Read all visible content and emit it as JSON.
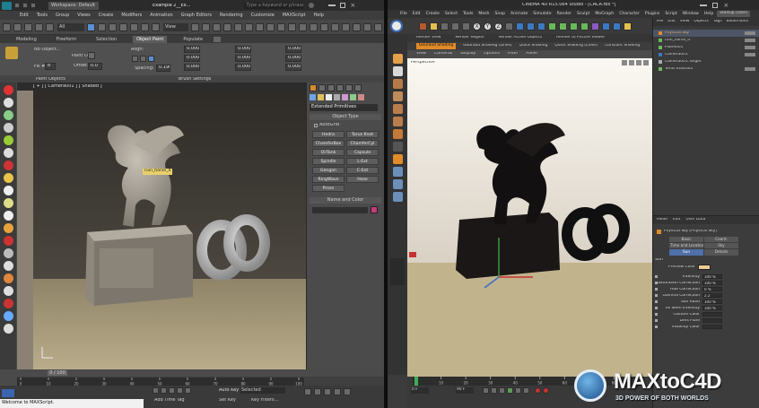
{
  "max": {
    "title_tabs": [
      "Workspace: Default",
      "Example 2__Ex..."
    ],
    "search_placeholder": "Type a keyword or phrase",
    "menu": [
      "Edit",
      "Tools",
      "Group",
      "Views",
      "Create",
      "Modifiers",
      "Animation",
      "Graph Editors",
      "Rendering",
      "Customize",
      "MAXScript",
      "Help"
    ],
    "toolbar": {
      "selection_filter": "All",
      "view_dropdown": "View"
    },
    "ribbon_tabs": [
      "Modeling",
      "Freeform",
      "Selection",
      "Object Paint",
      "Populate"
    ],
    "ribbon_active_tab": "Object Paint",
    "ribbon": {
      "no_object": "No Object...",
      "paint_on": "Paint On:",
      "fill": "Fill #:",
      "fill_value": "8",
      "offset": "Offset:",
      "offset_value": "0.0",
      "align": "Align:",
      "spacing": "Spacing:",
      "spacing_value": "0.190",
      "scale_rows": [
        "0.000",
        "0.000",
        "0.000",
        "0.000"
      ],
      "paint_objects": "Paint Objects",
      "brush_settings": "Brush Settings"
    },
    "viewport_label": "[ + ] [ Camera001 ] [ Shaded ]",
    "object_tooltip": "ruin_horse_4",
    "command_panel": {
      "category": "Extended Primitives",
      "section_object_type": "Object Type",
      "autogrid": "AutoGrid",
      "buttons": [
        "Hedra",
        "Torus Knot",
        "ChamferBox",
        "ChamferCyl",
        "OilTank",
        "Capsule",
        "Spindle",
        "L-Ext",
        "Gengon",
        "C-Ext",
        "RingWave",
        "Hose",
        "Prism",
        ""
      ],
      "section_name_color": "Name and Color"
    },
    "timeline": {
      "frame_readout": "0 / 100",
      "ticks": [
        "0",
        "10",
        "20",
        "30",
        "40",
        "50",
        "60",
        "70",
        "80",
        "90",
        "100"
      ]
    },
    "status": {
      "welcome": "Welcome to MAXScript.",
      "add_time_tag": "Add Time Tag",
      "auto_key": "Auto Key",
      "selected": "Selected",
      "set_key": "Set Key",
      "key_filters": "Key Filters..."
    }
  },
  "c4d": {
    "title": "CINEMA 4D R15.064 Studio - [CACA.fbx *]",
    "layout_label": "Startup (User)",
    "menu": [
      "File",
      "Edit",
      "Create",
      "Select",
      "Tools",
      "Mesh",
      "Snap",
      "Animate",
      "Simulate",
      "Render",
      "Sculpt",
      "MoGraph",
      "Character",
      "Plugins",
      "Script",
      "Window",
      "Help"
    ],
    "toolbar_axes": [
      "X",
      "Y",
      "Z"
    ],
    "render_bar": [
      "Render View",
      "Render Region",
      "Render Active Objects",
      "Render to Picture Viewer"
    ],
    "shade_bar": [
      "Gouraud Shading",
      "Gouraud Shading (Lines)",
      "Quick Shading",
      "Quick Shading (Lines)",
      "Constant Shading"
    ],
    "viewport_menu": [
      "View",
      "Cameras",
      "Display",
      "Options",
      "Filter",
      "Panel"
    ],
    "viewport_label": "Perspective",
    "object_manager": {
      "menu": [
        "File",
        "Edit",
        "View",
        "Objects",
        "Tags",
        "Bookmarks"
      ],
      "objects": [
        "Physical Sky",
        "ruin_horse_4",
        "Plane001",
        "Camera001",
        "Camera001.Target",
        "Torus Knot001"
      ]
    },
    "attribute_manager": {
      "menu": [
        "Mode",
        "Edit",
        "User Data"
      ],
      "object_title": "Physical Sky [Physical Sky]",
      "tabs": [
        "Basic",
        "Coord.",
        "Time and Location",
        "Sky",
        "Sun",
        "Details"
      ],
      "active_tab": "Sun",
      "section": "Sun",
      "preview_color_label": "Preview Color",
      "preview_color": "#f0c89a",
      "rows": [
        {
          "label": "Intensity",
          "value": "100 %"
        },
        {
          "label": "Saturation Correction",
          "value": "100 %"
        },
        {
          "label": "Hue Correction",
          "value": "0 %"
        },
        {
          "label": "Gamma Correction",
          "value": "2.2"
        },
        {
          "label": "Sun Ratio",
          "value": "100 %"
        },
        {
          "label": "As Seen Intensity",
          "value": "100 %"
        },
        {
          "label": "Custom Color",
          "value": ""
        },
        {
          "label": "Lens Flare",
          "value": ""
        },
        {
          "label": "Visibility Color",
          "value": ""
        }
      ]
    },
    "timeline": {
      "frame_start": "0 F",
      "frame_end": "90 F",
      "ticks": [
        "0",
        "10",
        "20",
        "30",
        "40",
        "50",
        "60",
        "70",
        "80",
        "90"
      ]
    }
  },
  "logo": {
    "brand": "MAXtoC4D",
    "tagline": "3D POWER OF BOTH WORLDS"
  },
  "colors": {
    "max_bg": "#4a4a4a",
    "max_viewport_wall": "#3a3530",
    "max_floor": "#b0a58a",
    "c4d_bg": "#3c3c3c",
    "c4d_sky": "#ece6dc",
    "c4d_ground": "#c2b48d",
    "accent_blue": "#3d6fb5",
    "accent_orange": "#e08a2a"
  }
}
